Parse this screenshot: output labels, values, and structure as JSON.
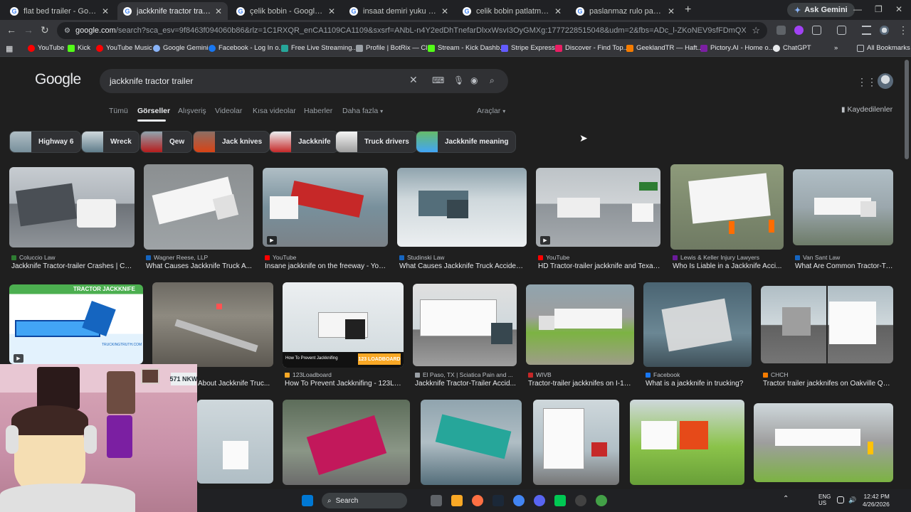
{
  "browser": {
    "tabs": [
      {
        "label": "flat bed trailer - Google'da Ara",
        "active": false
      },
      {
        "label": "jackknife tractor trailer - Google",
        "active": true
      },
      {
        "label": "çelik bobin - Google'da Ara",
        "active": false
      },
      {
        "label": "insaat demiri yuku - Google'da",
        "active": false
      },
      {
        "label": "celik bobin patlatma tir - Goog",
        "active": false
      },
      {
        "label": "paslanmaz rulo patlama - Goog",
        "active": false
      }
    ],
    "ask_gemini": "Ask Gemini",
    "url_host": "google.com",
    "url_rest": "/search?sca_esv=9f8463f094060b86&rlz=1C1RXQR_enCA1109CA1109&sxsrf=ANbL-n4Y2edDhTnefarDlxxWsvI3OyGMXg:1777228515048&udm=2&fbs=ADc_l-ZKoNEV9sfFDmQXhWqAiyKpLJtDZixqrPre1q8888cz8c20i..."
  },
  "bookmarks": [
    {
      "label": "YouTube",
      "color": "#ff0000"
    },
    {
      "label": "Kick",
      "color": "#53fc18"
    },
    {
      "label": "YouTube Music",
      "color": "#ff0000"
    },
    {
      "label": "Google Gemini",
      "color": "#8ab4f8"
    },
    {
      "label": "Facebook - Log In o...",
      "color": "#1877f2"
    },
    {
      "label": "Free Live Streaming...",
      "color": "#26a69a"
    },
    {
      "label": "Profile | BotRix — Cl...",
      "color": "#9aa0a6"
    },
    {
      "label": "Stream - Kick Dashb...",
      "color": "#53fc18"
    },
    {
      "label": "Stripe Express",
      "color": "#635bff"
    },
    {
      "label": "Discover - Find Top...",
      "color": "#e91e63"
    },
    {
      "label": "GeeklandTR — Haft...",
      "color": "#f57c00"
    },
    {
      "label": "Pictory.AI - Home o...",
      "color": "#7b1fa2"
    },
    {
      "label": "ChatGPT",
      "color": "#e8eaed"
    }
  ],
  "bookmarks_all": "All Bookmarks",
  "google": {
    "logo": "Google",
    "query": "jackknife tractor trailer",
    "tabs": [
      "Tümü",
      "Görseller",
      "Alışveriş",
      "Videolar",
      "Kısa videolar",
      "Haberler",
      "Daha fazla"
    ],
    "active_tab": "Görseller",
    "tools": "Araçlar",
    "saved": "Kaydedilenler",
    "chips": [
      "Highway 6",
      "Wreck",
      "Qew",
      "Jack knives",
      "Jackknife",
      "Truck drivers",
      "Jackknife meaning"
    ]
  },
  "results": [
    {
      "source": "Coluccio Law",
      "title": "Jackknife Tractor-trailer Crashes | Col...",
      "color": "#2e7d32"
    },
    {
      "source": "Wagner Reese, LLP",
      "title": "What Causes Jackknife Truck A...",
      "color": "#1565c0"
    },
    {
      "source": "YouTube",
      "title": "Insane jackknife on the freeway - You...",
      "color": "#ff0000"
    },
    {
      "source": "Studinski Law",
      "title": "What Causes Jackknife Truck Accident...",
      "color": "#1565c0"
    },
    {
      "source": "YouTube",
      "title": "HD Tractor-trailer jackknife and Texas...",
      "color": "#ff0000"
    },
    {
      "source": "Lewis & Keller Injury Lawyers",
      "title": "Who Is Liable in a Jackknife Acci...",
      "color": "#6a1b9a"
    },
    {
      "source": "Van Sant Law",
      "title": "What Are Common Tractor-Tr...",
      "color": "#1565c0"
    },
    {
      "source": "",
      "title": "About Jackknife Truc...",
      "color": "#9aa0a6"
    },
    {
      "source": "123Loadboard",
      "title": "How To Prevent Jackknifing - 123Lo...",
      "color": "#f9a825"
    },
    {
      "source": "El Paso, TX | Sciatica Pain and ...",
      "title": "Jackknife Tractor-Trailer Accid...",
      "color": "#9aa0a6"
    },
    {
      "source": "WIVB",
      "title": "Tractor-trailer jackknifes on I-19...",
      "color": "#c62828"
    },
    {
      "source": "Facebook",
      "title": "What is a jackknife in trucking?",
      "color": "#1877f2"
    },
    {
      "source": "CHCH",
      "title": "Tractor trailer jackknifes on Oakville QE...",
      "color": "#f57c00"
    }
  ],
  "thumb_texts": {
    "tractor_jackknife": "TRACTOR JACKKNIFE",
    "trucking_truth": "TRUCKINGTRUTH.COM",
    "how_to_prevent": "How To Prevent Jackknifing",
    "loadboard": "123 LOADBOARD",
    "sign_571": "571",
    "sign_nkw": "NKW"
  },
  "taskbar": {
    "search": "Search",
    "lang_top": "ENG",
    "lang_bottom": "US",
    "time": "12:42 PM",
    "date": "4/26/2026"
  }
}
